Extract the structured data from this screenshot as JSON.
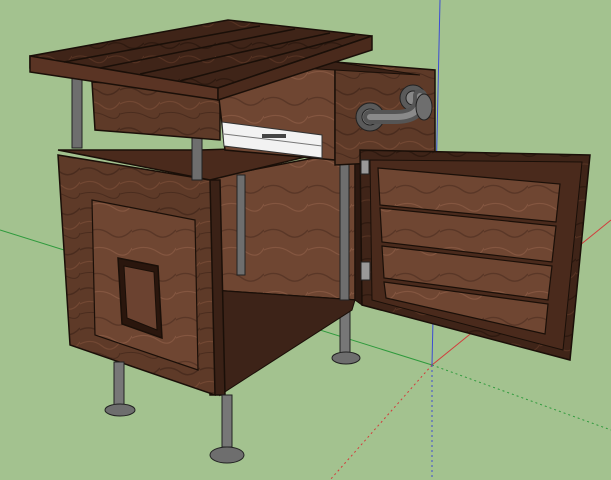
{
  "scene": {
    "background_color": "#a3c28f",
    "wood_dark": "#4a2a1c",
    "wood_mid": "#6b4230",
    "wood_light": "#7d5138",
    "edge_color": "#1a0f08",
    "metal_color": "#6e6e6e",
    "axis_red": "#d23c3c",
    "axis_green": "#2e9a3c",
    "axis_blue": "#3c4cd2"
  },
  "model": {
    "object": "nightstand-cabinet",
    "parts": [
      "top-slats",
      "drawer",
      "drawer-slide",
      "pipe-handle",
      "cabinet-body",
      "door-with-slats",
      "pet-door-opening",
      "pipe-legs",
      "hinges"
    ]
  }
}
